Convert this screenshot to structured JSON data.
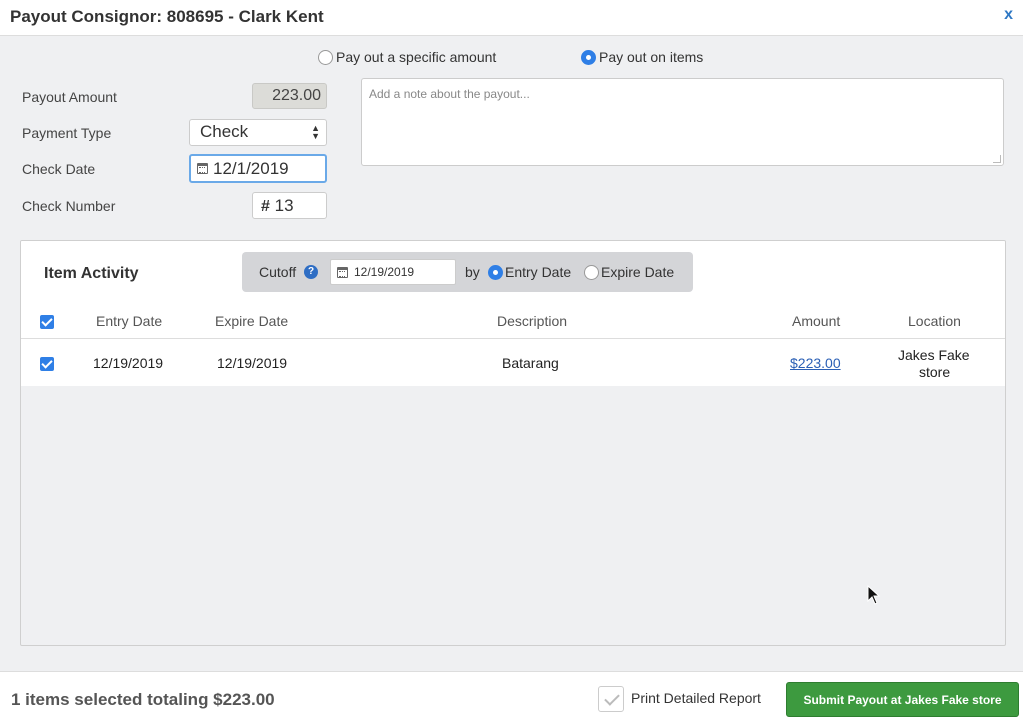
{
  "header": {
    "title": "Payout Consignor: 808695 - Clark Kent",
    "close_label": "x"
  },
  "payout_mode": {
    "options": [
      {
        "label": "Pay out a specific amount",
        "selected": false
      },
      {
        "label": "Pay out on items",
        "selected": true
      }
    ]
  },
  "form": {
    "payout_amount_label": "Payout Amount",
    "payout_amount_value": "223.00",
    "payment_type_label": "Payment Type",
    "payment_type_value": "Check",
    "check_date_label": "Check Date",
    "check_date_value": "12/1/2019",
    "check_number_label": "Check Number",
    "check_number_prefix": "#",
    "check_number_value": "13",
    "note_placeholder": "Add a note about the payout..."
  },
  "item_activity": {
    "title": "Item Activity",
    "cutoff_label": "Cutoff",
    "help_glyph": "?",
    "cutoff_date": "12/19/2019",
    "by_label": "by",
    "by_options": [
      {
        "label": "Entry Date",
        "selected": true
      },
      {
        "label": "Expire Date",
        "selected": false
      }
    ],
    "columns": [
      "Entry Date",
      "Expire Date",
      "Description",
      "Amount",
      "Location"
    ],
    "rows": [
      {
        "checked": true,
        "entry_date": "12/19/2019",
        "expire_date": "12/19/2019",
        "description": "Batarang",
        "amount": "$223.00",
        "location_line1": "Jakes Fake",
        "location_line2": "store"
      }
    ]
  },
  "footer": {
    "summary": "1 items selected totaling $223.00",
    "print_label": "Print Detailed Report",
    "submit_label": "Submit Payout at Jakes Fake store"
  },
  "colors": {
    "accent": "#2f7fe6",
    "submit": "#3d9a3f",
    "link": "#2a5fb5"
  },
  "icons": [
    "close-icon",
    "calendar-icon",
    "help-icon",
    "checkbox-icon",
    "cursor-icon"
  ]
}
